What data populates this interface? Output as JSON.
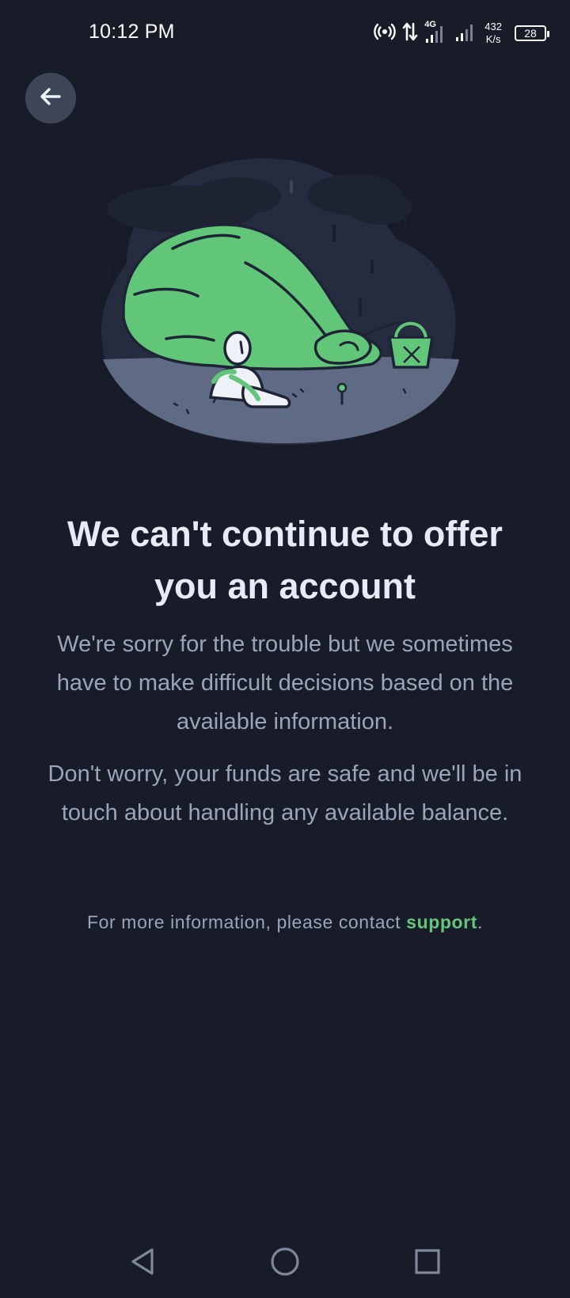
{
  "status_bar": {
    "time": "10:12 PM",
    "network_type": "4G",
    "net_speed_value": "432",
    "net_speed_unit": "K/s",
    "battery_level": "28"
  },
  "header": {
    "back_icon": "arrow-left-icon"
  },
  "illustration": {
    "icon": "sleeping-blob-illustration",
    "colors": {
      "background_blob": "#262c3f",
      "ground": "#5f6a84",
      "creature": "#62c679",
      "outline": "#1e2436",
      "figure": "#eef1f7"
    }
  },
  "main": {
    "title": "We can't continue to offer you an account",
    "paragraph_1": "We're sorry for the trouble but we sometimes have to make difficult decisions based on the available information.",
    "paragraph_2": "Don't worry, your funds are safe and we'll be in touch about handling any available balance.",
    "contact_prefix": "For more information, please contact ",
    "support_link": "support",
    "contact_suffix": "."
  },
  "nav_bar": {
    "back_icon": "triangle-back-icon",
    "home_icon": "circle-home-icon",
    "recents_icon": "square-recents-icon"
  },
  "theme": {
    "background": "#181c28",
    "accent": "#63c67a",
    "body_text": "#9aa5bb",
    "heading_text": "#e6ebf5"
  }
}
